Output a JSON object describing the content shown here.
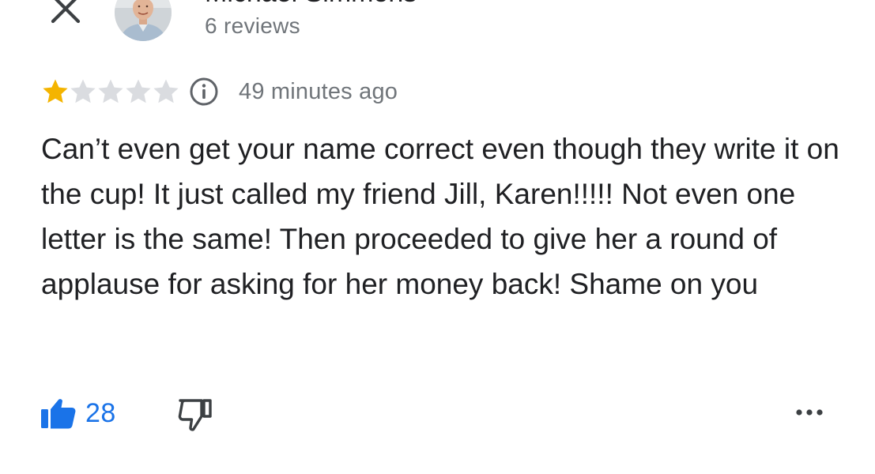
{
  "header": {
    "reviewer_name": "Michael Simmons",
    "review_count": "6 reviews",
    "close_icon": "close-icon",
    "avatar_icon": "avatar"
  },
  "rating": {
    "stars": 1,
    "max_stars": 5,
    "filled_color": "#f4b400",
    "empty_color": "#dadce0",
    "timestamp": "49 minutes ago",
    "info_icon": "info-icon"
  },
  "review": {
    "text": "Can’t even get your name correct even though they write it on the cup! It just called my friend Jill, Karen!!!!! Not even one letter is the same! Then proceeded to give her a round of applause for asking for her money back! Shame on you"
  },
  "actions": {
    "like_count": "28",
    "like_icon": "thumbs-up-icon",
    "dislike_icon": "thumbs-down-icon",
    "more_icon": "more-options-icon",
    "accent_color": "#1a73e8"
  }
}
